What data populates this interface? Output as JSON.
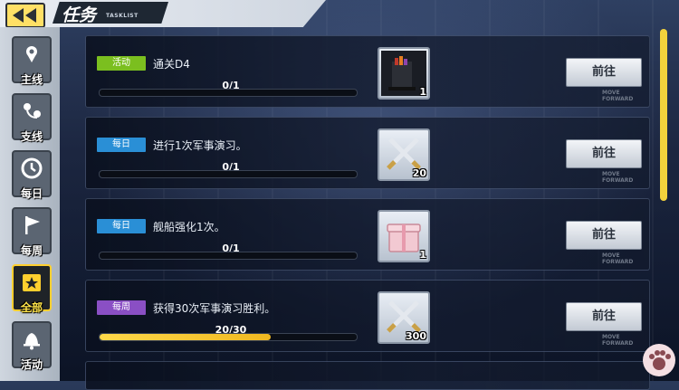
{
  "header": {
    "title": "任务",
    "subtitle": "TASKLIST"
  },
  "sidebar": {
    "items": [
      {
        "label": "主线",
        "icon": "map-pin-icon",
        "active": false
      },
      {
        "label": "支线",
        "icon": "route-pins-icon",
        "active": false
      },
      {
        "label": "每日",
        "icon": "clock-icon",
        "active": false
      },
      {
        "label": "每周",
        "icon": "flag-icon",
        "active": false
      },
      {
        "label": "全部",
        "icon": "star-calendar-icon",
        "active": true
      },
      {
        "label": "活动",
        "icon": "bell-icon",
        "active": false
      }
    ]
  },
  "tasks": [
    {
      "badge": "活动",
      "badge_color": "#7bbf1f",
      "name": "通关D4",
      "progress": "0/1",
      "progress_fraction": 0,
      "reward_icon": "bookshelf-item-icon",
      "reward_count": "1",
      "button": "前往",
      "button_sub": "MOVE FORWARD"
    },
    {
      "badge": "每日",
      "badge_color": "#2a8fd6",
      "name": "进行1次军事演习。",
      "progress": "0/1",
      "progress_fraction": 0,
      "reward_icon": "crossed-swords-icon",
      "reward_count": "20",
      "button": "前往",
      "button_sub": "MOVE FORWARD"
    },
    {
      "badge": "每日",
      "badge_color": "#2a8fd6",
      "name": "舰船强化1次。",
      "progress": "0/1",
      "progress_fraction": 0,
      "reward_icon": "gift-box-icon",
      "reward_count": "1",
      "button": "前往",
      "button_sub": "MOVE FORWARD"
    },
    {
      "badge": "每周",
      "badge_color": "#8a4fc4",
      "name": "获得30次军事演习胜利。",
      "progress": "20/30",
      "progress_fraction": 0.6667,
      "reward_icon": "crossed-swords-icon",
      "reward_count": "300",
      "button": "前往",
      "button_sub": "MOVE FORWARD"
    }
  ]
}
